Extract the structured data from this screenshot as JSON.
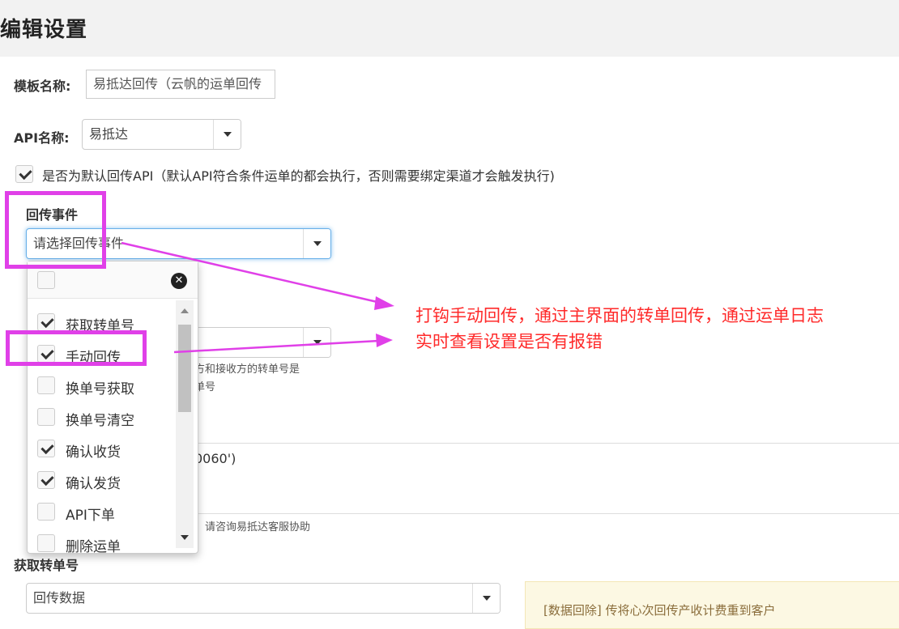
{
  "page": {
    "title": "编辑设置"
  },
  "template": {
    "label": "模板名称:",
    "value": "易抵达回传（云帆的运单回传"
  },
  "api": {
    "label": "API名称:",
    "value": "易抵达"
  },
  "default_api": {
    "checked": true,
    "label": "是否为默认回传API（默认API符合条件运单的都会执行，否则需要绑定渠道才会触发执行)"
  },
  "events": {
    "label": "回传事件",
    "placeholder": "请选择回传事件"
  },
  "dropdown": {
    "options": [
      {
        "label": "获取转单号",
        "checked": true
      },
      {
        "label": "手动回传",
        "checked": true
      },
      {
        "label": "换单号获取",
        "checked": false
      },
      {
        "label": "换单号清空",
        "checked": false
      },
      {
        "label": "确认收货",
        "checked": true
      },
      {
        "label": "确认发货",
        "checked": true
      },
      {
        "label": "API下单",
        "checked": false
      },
      {
        "label": "删除运单",
        "checked": false
      }
    ]
  },
  "background": {
    "help_line1": "方和接收方的转单号是",
    "help_line2": "单号",
    "code_fragment": "0060')",
    "help_line3": "，请咨询易抵达客服协助"
  },
  "section_fetch": {
    "label": "获取转单号"
  },
  "return_data": {
    "value": "回传数据"
  },
  "notice": {
    "text": "[数据回除] 传将心次回传产收计费重到客户"
  },
  "annotation": {
    "line1": "打钩手动回传，通过主界面的转单回传，通过运单日志",
    "line2": "实时查看设置是否有报错"
  },
  "colors": {
    "highlight": "#e040e8",
    "annotation": "#ff2a2a",
    "focus": "#66afe9"
  }
}
